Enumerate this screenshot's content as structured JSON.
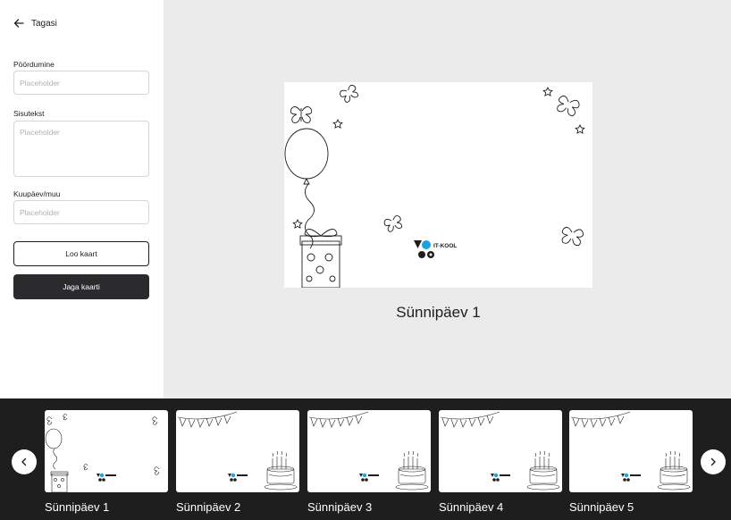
{
  "sidebar": {
    "back_label": "Tagasi",
    "greeting": {
      "label": "Pöördumine",
      "placeholder": "Placeholder",
      "value": ""
    },
    "body_text": {
      "label": "Sisutekst",
      "placeholder": "Placeholder",
      "value": ""
    },
    "date": {
      "label": "Kuupäev/muu",
      "placeholder": "Placeholder",
      "value": ""
    },
    "create_button": "Loo kaart",
    "share_button": "Jaga kaarti"
  },
  "preview": {
    "title": "Sünnipäev 1",
    "logo_text": "IT-KOOL"
  },
  "carousel": {
    "items": [
      {
        "label": "Sünnipäev 1"
      },
      {
        "label": "Sünnipäev 2"
      },
      {
        "label": "Sünnipäev 3"
      },
      {
        "label": "Sünnipäev 4"
      },
      {
        "label": "Sünnipäev 5"
      }
    ]
  },
  "colors": {
    "accent": "#1aa3e0",
    "strip_bg": "#1e1e1f",
    "dark_button": "#2b2b2d"
  }
}
